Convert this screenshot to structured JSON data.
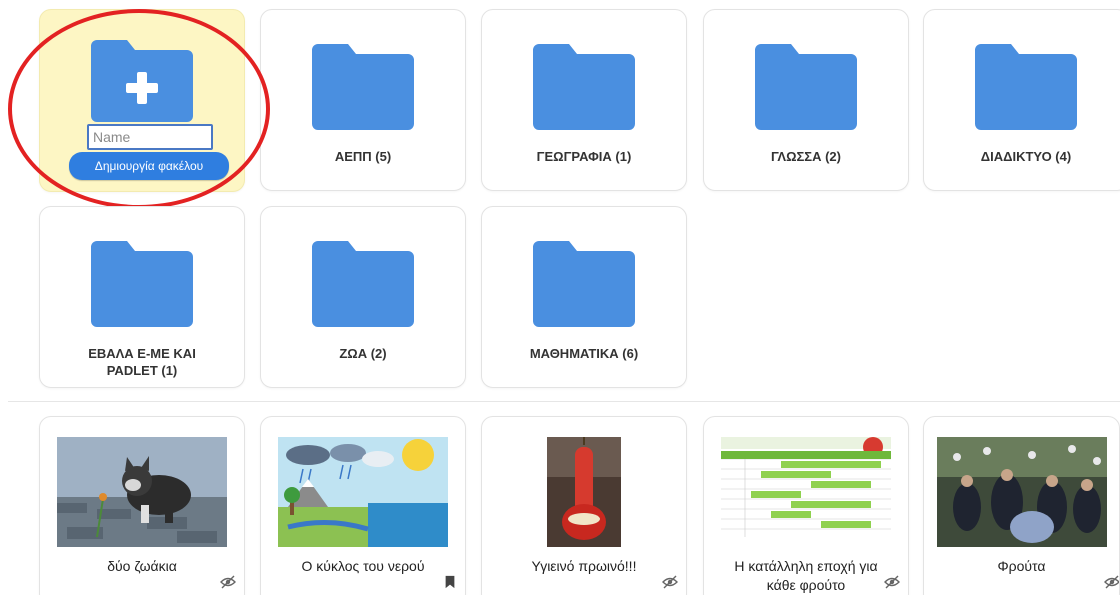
{
  "new_folder": {
    "input_placeholder": "Name",
    "input_value": "",
    "create_button_label": "Δημιουργία φακέλου",
    "icon": "folder-plus-icon"
  },
  "folders": [
    {
      "label": "ΑΕΠΠ (5)"
    },
    {
      "label": "ΓΕΩΓΡΑΦΙΑ (1)"
    },
    {
      "label": "ΓΛΩΣΣΑ (2)"
    },
    {
      "label": "ΔΙΑΔΙΚΤΥΟ (4)"
    },
    {
      "label": "ΕΒΑΛΑ Ε-ΜΕ ΚΑΙ PADLET (1)"
    },
    {
      "label": "ΖΩΑ (2)"
    },
    {
      "label": "ΜΑΘΗΜΑΤΙΚΑ (6)"
    }
  ],
  "items": [
    {
      "title": "δύο ζωάκια",
      "status_icon": "hidden-eye-icon"
    },
    {
      "title": "Ο κύκλος του νερού",
      "status_icon": "bookmark-icon"
    },
    {
      "title": "Υγιεινό πρωινό!!!",
      "status_icon": "hidden-eye-icon"
    },
    {
      "title": "Η κατάλληλη εποχή για κάθε φρούτο",
      "status_icon": "hidden-eye-icon"
    },
    {
      "title": "Φρούτα",
      "status_icon": "hidden-eye-icon"
    }
  ],
  "colors": {
    "folder_blue": "#4a8fe0",
    "new_folder_bg": "#fdf6c4",
    "button_blue": "#2f7ee0",
    "annotation_red": "#e32222"
  }
}
